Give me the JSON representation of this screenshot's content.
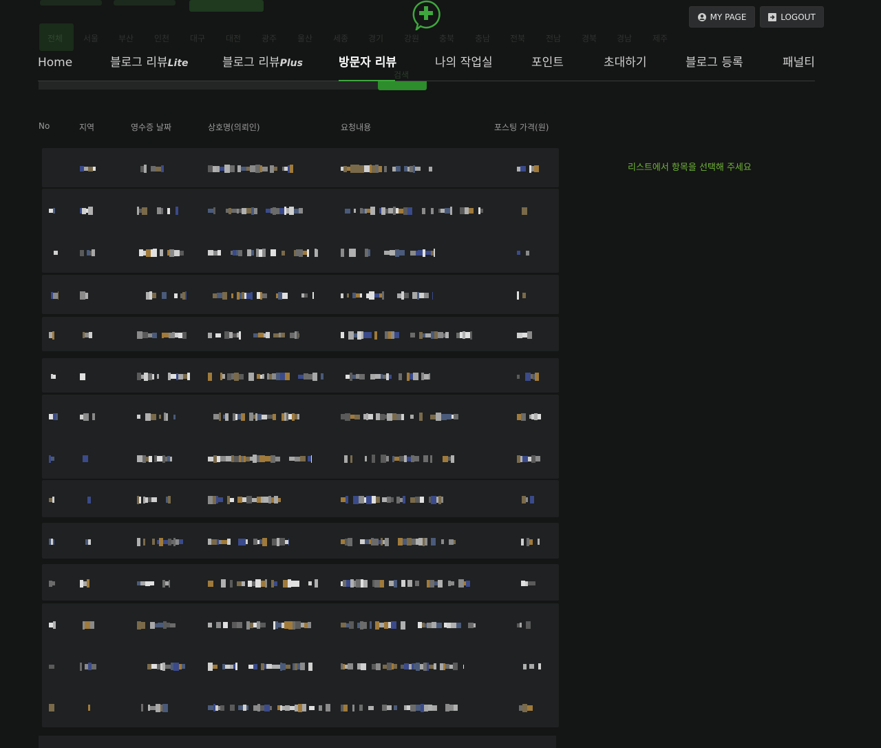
{
  "top_buttons": {
    "mypage": "MY PAGE",
    "logout": "LOGOUT"
  },
  "ghost_regions": [
    "전체",
    "서울",
    "부산",
    "인천",
    "대구",
    "대전",
    "광주",
    "울산",
    "세종",
    "경기",
    "강원",
    "충북",
    "충남",
    "전북",
    "전남",
    "경북",
    "경남",
    "제주"
  ],
  "ghost_search_btn": "검색",
  "nav": {
    "home": "Home",
    "blog_lite_main": "블로그 리뷰",
    "blog_lite_sub": "Lite",
    "blog_plus_main": "블로그 리뷰",
    "blog_plus_sub": "Plus",
    "visitor_review": "방문자 리뷰",
    "my_workspace": "나의 작업실",
    "point": "포인트",
    "invite": "초대하기",
    "blog_register": "블로그 등록",
    "penalty": "패널티"
  },
  "table": {
    "headers": {
      "no": "No",
      "region": "지역",
      "receipt_date": "영수증 날짜",
      "business": "상호명(의뢰인)",
      "request": "요청내용",
      "price": "포스팅 가격(원)"
    },
    "rows_count_visible": 14
  },
  "detail_panel": {
    "placeholder": "리스트에서 항목을 선택해 주세요"
  },
  "colors": {
    "accent": "#3ea73d",
    "background": "#141515",
    "row_bg": "#1f2122",
    "message": "#6fb536"
  },
  "icons": [
    "logo-plus-bubble-icon",
    "user-circle-icon",
    "logout-icon"
  ]
}
